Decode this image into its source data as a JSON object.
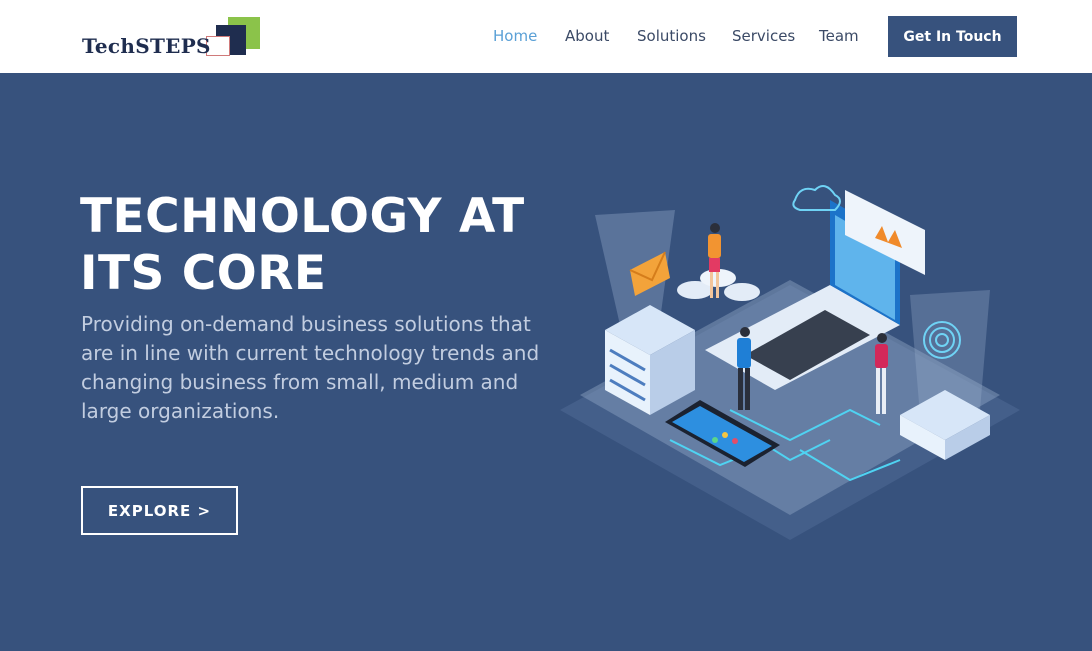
{
  "brand": {
    "logo_text": "TechSTEPS"
  },
  "nav": {
    "items": [
      {
        "label": "Home",
        "active": true
      },
      {
        "label": "About",
        "active": false
      },
      {
        "label": "Solutions",
        "active": false
      },
      {
        "label": "Services",
        "active": false
      },
      {
        "label": "Team",
        "active": false
      }
    ],
    "cta_label": "Get In Touch"
  },
  "hero": {
    "title": "TECHNOLOGY AT ITS CORE",
    "subtitle": "Providing on-demand business solutions that are in line with current technology trends and changing business from small, medium and large organizations.",
    "button_label": "EXPLORE  >"
  },
  "colors": {
    "primary": "#37527d",
    "accent_link": "#5aa0d6",
    "logo_green": "#8bc34a",
    "logo_navy": "#1f2d4f"
  }
}
